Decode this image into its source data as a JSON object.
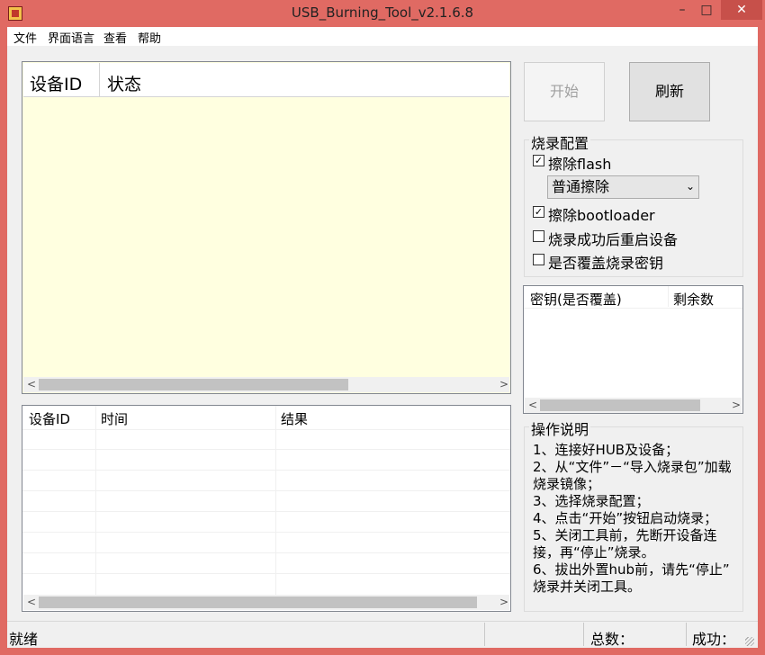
{
  "window": {
    "title": "USB_Burning_Tool_v2.1.6.8",
    "minimize": "–",
    "maximize": "□",
    "close": "✕"
  },
  "menu": [
    "文件",
    "界面语言",
    "查看",
    "帮助"
  ],
  "device_table": {
    "columns": [
      "设备ID",
      "状态"
    ]
  },
  "result_table": {
    "columns": [
      "设备ID",
      "时间",
      "结果"
    ]
  },
  "buttons": {
    "start": "开始",
    "refresh": "刷新"
  },
  "config": {
    "title": "烧录配置",
    "options": [
      {
        "label": "擦除flash",
        "checked": true
      },
      {
        "label": "擦除bootloader",
        "checked": true
      },
      {
        "label": "烧录成功后重启设备",
        "checked": false
      },
      {
        "label": "是否覆盖烧录密钥",
        "checked": false
      }
    ],
    "erase_mode": "普通擦除"
  },
  "key_table": {
    "columns": [
      "密钥(是否覆盖)",
      "剩余数"
    ]
  },
  "help": {
    "title": "操作说明",
    "lines": [
      "1、连接好HUB及设备；",
      "2、从“文件”－“导入烧录包”加载",
      "烧录镜像；",
      "3、选择烧录配置；",
      "4、点击“开始”按钮启动烧录；",
      "5、关闭工具前，先断开设备连",
      "接，再“停止”烧录。",
      "6、拔出外置hub前，请先“停止”",
      "烧录并关闭工具。"
    ]
  },
  "status": {
    "state": "就绪",
    "total_label": "总数：",
    "success_label": "成功："
  },
  "icons": {
    "left_arrow": "<",
    "right_arrow": ">",
    "dropdown": "⌄",
    "check": "✓"
  }
}
